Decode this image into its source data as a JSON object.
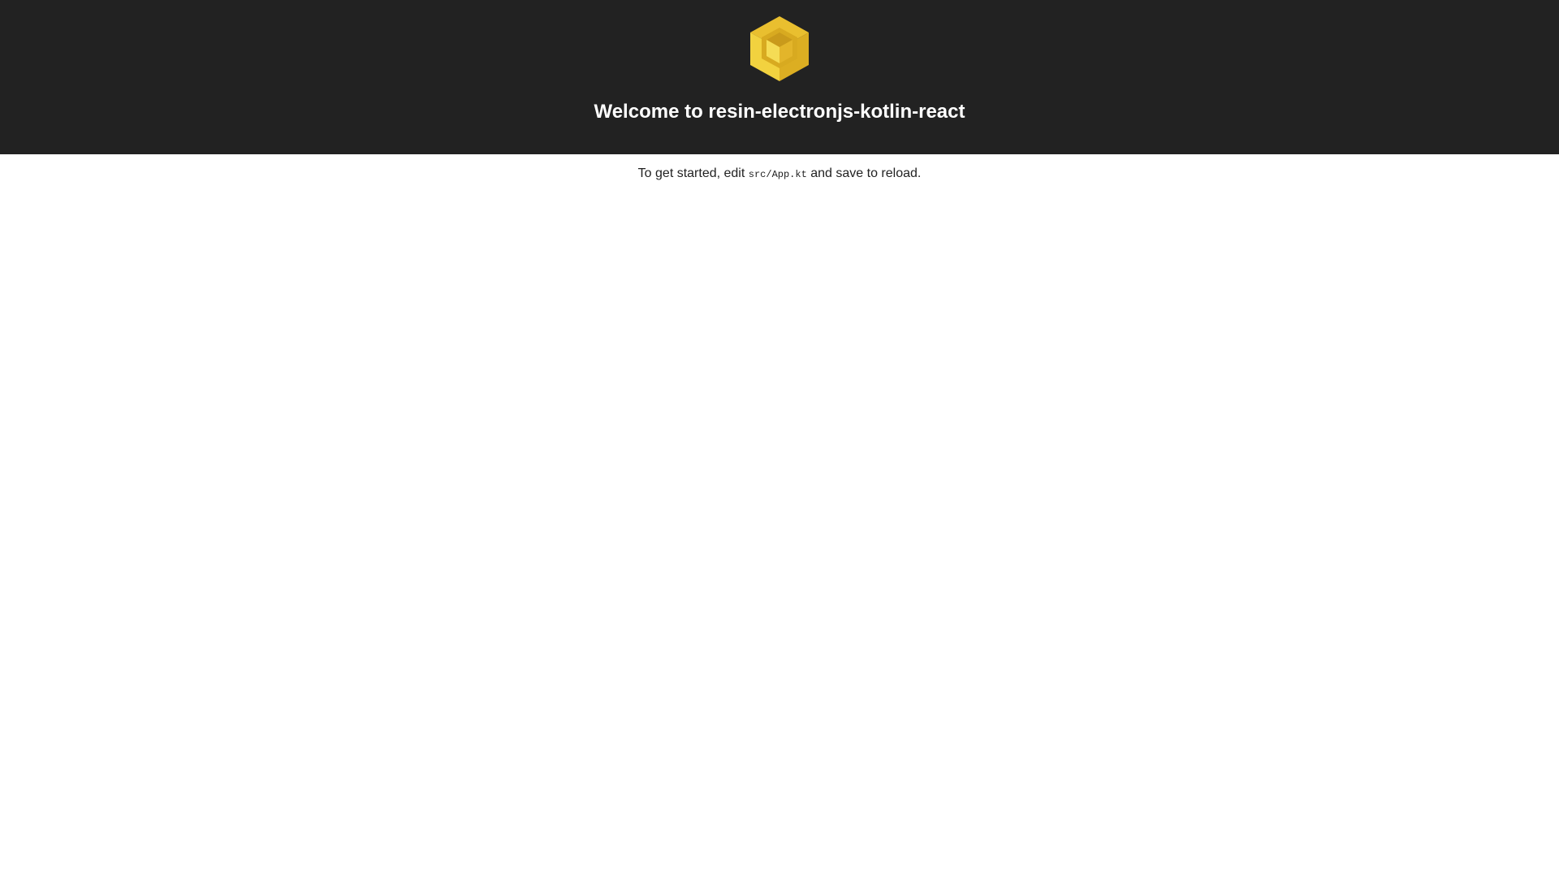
{
  "header": {
    "logo_icon": "cube-logo-icon",
    "title": "Welcome to resin-electronjs-kotlin-react",
    "background_color": "#222222",
    "logo_colors": {
      "top": "#e9bf2f",
      "left": "#f2d23f",
      "right": "#dcae22",
      "inner": "#c99a1b"
    }
  },
  "intro": {
    "before": "To get started, edit",
    "code": "src/App.kt",
    "after": "and save to reload."
  }
}
